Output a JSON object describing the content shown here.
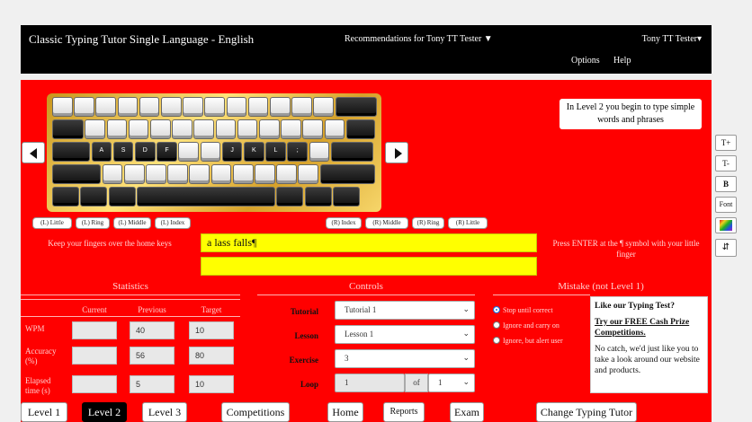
{
  "header": {
    "title": "Classic Typing Tutor Single Language - English",
    "recommendations": "Recommendations for Tony TT Tester ▼",
    "user": "Tony TT Tester▾",
    "options": "Options",
    "help": "Help"
  },
  "keyboard": {
    "home_keys": [
      "A",
      "S",
      "D",
      "F",
      "J",
      "K",
      "L",
      ";"
    ]
  },
  "info_box": "In Level 2 you begin to type simple words and phrases",
  "fingers": {
    "left": [
      "(L) Little",
      "(L) Ring",
      "(L) Middle",
      "(L) Index"
    ],
    "right": [
      "(R) Index",
      "(R) Middle",
      "(R) Ring",
      "(R) Little"
    ]
  },
  "hints": {
    "left": "Keep your fingers over the home keys",
    "right": "Press ENTER at the ¶ symbol with your little finger"
  },
  "typing": {
    "line1": "a lass falls¶",
    "line2": ""
  },
  "statistics": {
    "title": "Statistics",
    "columns": [
      "Current",
      "Previous",
      "Target"
    ],
    "rows": [
      {
        "label": "WPM",
        "current": "",
        "previous": "40",
        "target": "10"
      },
      {
        "label": "Accuracy (%)",
        "current": "",
        "previous": "56",
        "target": "80"
      },
      {
        "label": "Elapsed time (s)",
        "current": "",
        "previous": "5",
        "target": "10"
      }
    ]
  },
  "controls": {
    "title": "Controls",
    "tutorial_label": "Tutorial",
    "tutorial_value": "Tutorial 1",
    "lesson_label": "Lesson",
    "lesson_value": "Lesson 1",
    "exercise_label": "Exercise",
    "exercise_value": "3",
    "loop_label": "Loop",
    "loop_value": "1",
    "loop_of": "of",
    "loop_total": "1"
  },
  "mistake": {
    "title": "Mistake (not Level 1)",
    "options": [
      "Stop until correct",
      "Ignore and carry on",
      "Ignore, but alert user"
    ],
    "selected_index": 0
  },
  "promo": {
    "heading": "Like our Typing Test?",
    "link": "Try our FREE Cash Prize Competitions.",
    "body": "No catch, we'd just like you to take a look around our website and products."
  },
  "side_buttons": [
    "T+",
    "T-",
    "B",
    "Font",
    "color-swatch-icon",
    "up-down-arrows-icon"
  ],
  "nav": {
    "level1": "Level 1",
    "level2": "Level 2",
    "level3": "Level 3",
    "competitions": "Competitions",
    "home": "Home",
    "reports": "Reports",
    "exam": "Exam",
    "change": "Change Typing Tutor"
  }
}
